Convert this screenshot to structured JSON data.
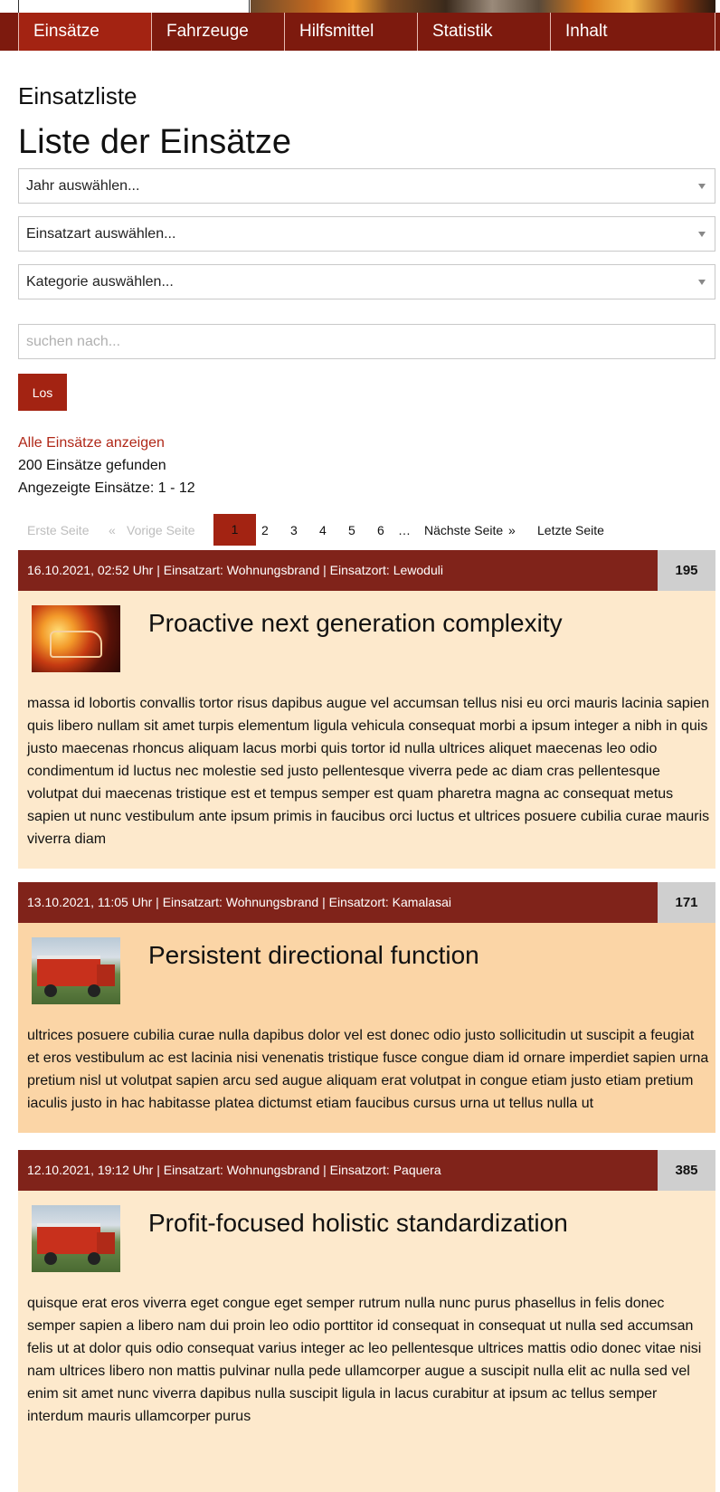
{
  "nav": {
    "items": [
      {
        "label": "Einsätze"
      },
      {
        "label": "Fahrzeuge"
      },
      {
        "label": "Hilfsmittel"
      },
      {
        "label": "Statistik"
      },
      {
        "label": "Inhalt"
      }
    ]
  },
  "page": {
    "section_title": "Einsatzliste",
    "title": "Liste der Einsätze"
  },
  "filters": {
    "year_select": "Jahr auswählen...",
    "type_select": "Einsatzart auswählen...",
    "category_select": "Kategorie auswählen...",
    "search_placeholder": "suchen nach...",
    "go_label": "Los"
  },
  "results": {
    "show_all": "Alle Einsätze anzeigen",
    "found": "200 Einsätze gefunden",
    "shown": "Angezeigte Einsätze: 1 - 12"
  },
  "pagination": {
    "first": "Erste Seite",
    "prev_arrow": "«",
    "prev": "Vorige Seite",
    "current": "1",
    "pages": [
      "2",
      "3",
      "4",
      "5",
      "6"
    ],
    "ellipsis": "…",
    "next": "Nächste Seite",
    "next_arrow": "»",
    "last": "Letzte Seite"
  },
  "missions": [
    {
      "meta": "16.10.2021, 02:52 Uhr | Einsatzart: Wohnungsbrand | Einsatzort: Lewoduli",
      "number": "195",
      "title": "Proactive next generation complexity",
      "text": "massa id lobortis convallis tortor risus dapibus augue vel accumsan tellus nisi eu orci mauris lacinia sapien quis libero nullam sit amet turpis elementum ligula vehicula consequat morbi a ipsum integer a nibh in quis justo maecenas rhoncus aliquam lacus morbi quis tortor id nulla ultrices aliquet maecenas leo odio condimentum id luctus nec molestie sed justo pellentesque viverra pede ac diam cras pellentesque volutpat dui maecenas tristique est et tempus semper est quam pharetra magna ac consequat metus sapien ut nunc vestibulum ante ipsum primis in faucibus orci luctus et ultrices posuere cubilia curae mauris viverra diam",
      "bg_color": "#fde9cc"
    },
    {
      "meta": "13.10.2021, 11:05 Uhr | Einsatzart: Wohnungsbrand | Einsatzort: Kamalasai",
      "number": "171",
      "title": "Persistent directional function",
      "text": "ultrices posuere cubilia curae nulla dapibus dolor vel est donec odio justo sollicitudin ut suscipit a feugiat et eros vestibulum ac est lacinia nisi venenatis tristique fusce congue diam id ornare imperdiet sapien urna pretium nisl ut volutpat sapien arcu sed augue aliquam erat volutpat in congue etiam justo etiam pretium iaculis justo in hac habitasse platea dictumst etiam faucibus cursus urna ut tellus nulla ut",
      "bg_color": "#fbd5a6"
    },
    {
      "meta": "12.10.2021, 19:12 Uhr | Einsatzart: Wohnungsbrand | Einsatzort: Paquera",
      "number": "385",
      "title": "Profit-focused holistic standardization",
      "text": "quisque erat eros viverra eget congue eget semper rutrum nulla nunc purus phasellus in felis donec semper sapien a libero nam dui proin leo odio porttitor id consequat in consequat ut nulla sed accumsan felis ut at dolor quis odio consequat varius integer ac leo pellentesque ultrices mattis odio donec vitae nisi nam ultrices libero non mattis pulvinar nulla pede ullamcorper augue a suscipit nulla elit ac nulla sed vel enim sit amet nunc viverra dapibus nulla suscipit ligula in lacus curabitur at ipsum ac tellus semper interdum mauris ullamcorper purus",
      "bg_color": "#fde9cc"
    }
  ],
  "colors": {
    "nav_bg": "#7d1a0e",
    "nav_active": "#a32312",
    "accent": "#a32312",
    "card_header": "#80231a"
  }
}
